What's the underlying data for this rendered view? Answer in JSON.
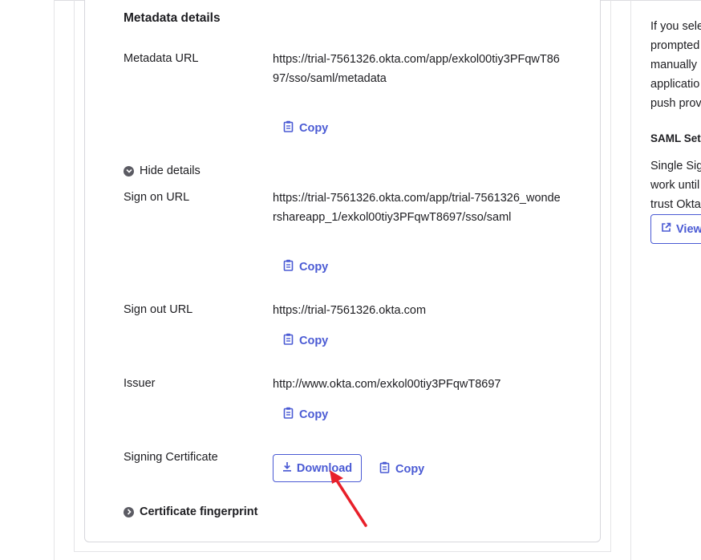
{
  "metadata": {
    "title": "Metadata details",
    "rows": [
      {
        "label": "Metadata URL",
        "value": "https://trial-7561326.okta.com/app/exkol00tiy3PFqwT8697/sso/saml/metadata",
        "copy": "Copy"
      },
      {
        "label": "Sign on URL",
        "value": "https://trial-7561326.okta.com/app/trial-7561326_wondershareapp_1/exkol00tiy3PFqwT8697/sso/saml",
        "copy": "Copy"
      },
      {
        "label": "Sign out URL",
        "value": "https://trial-7561326.okta.com",
        "copy": "Copy"
      },
      {
        "label": "Issuer",
        "value": "http://www.okta.com/exkol00tiy3PFqwT8697",
        "copy": "Copy"
      }
    ],
    "hide_details": "Hide details",
    "signing_certificate": {
      "label": "Signing Certificate",
      "download": "Download",
      "copy": "Copy"
    },
    "certificate_fingerprint": "Certificate fingerprint"
  },
  "side": {
    "lines": [
      "If you sele",
      "prompted",
      "manually",
      "applicatio",
      "push prov"
    ],
    "saml_title": "SAML Setu",
    "saml_lines": [
      "Single Sig",
      "work until",
      "trust Okta"
    ],
    "view_button": "View"
  },
  "colors": {
    "accent": "#4a5ad4",
    "annotation_arrow": "#e8202a"
  }
}
